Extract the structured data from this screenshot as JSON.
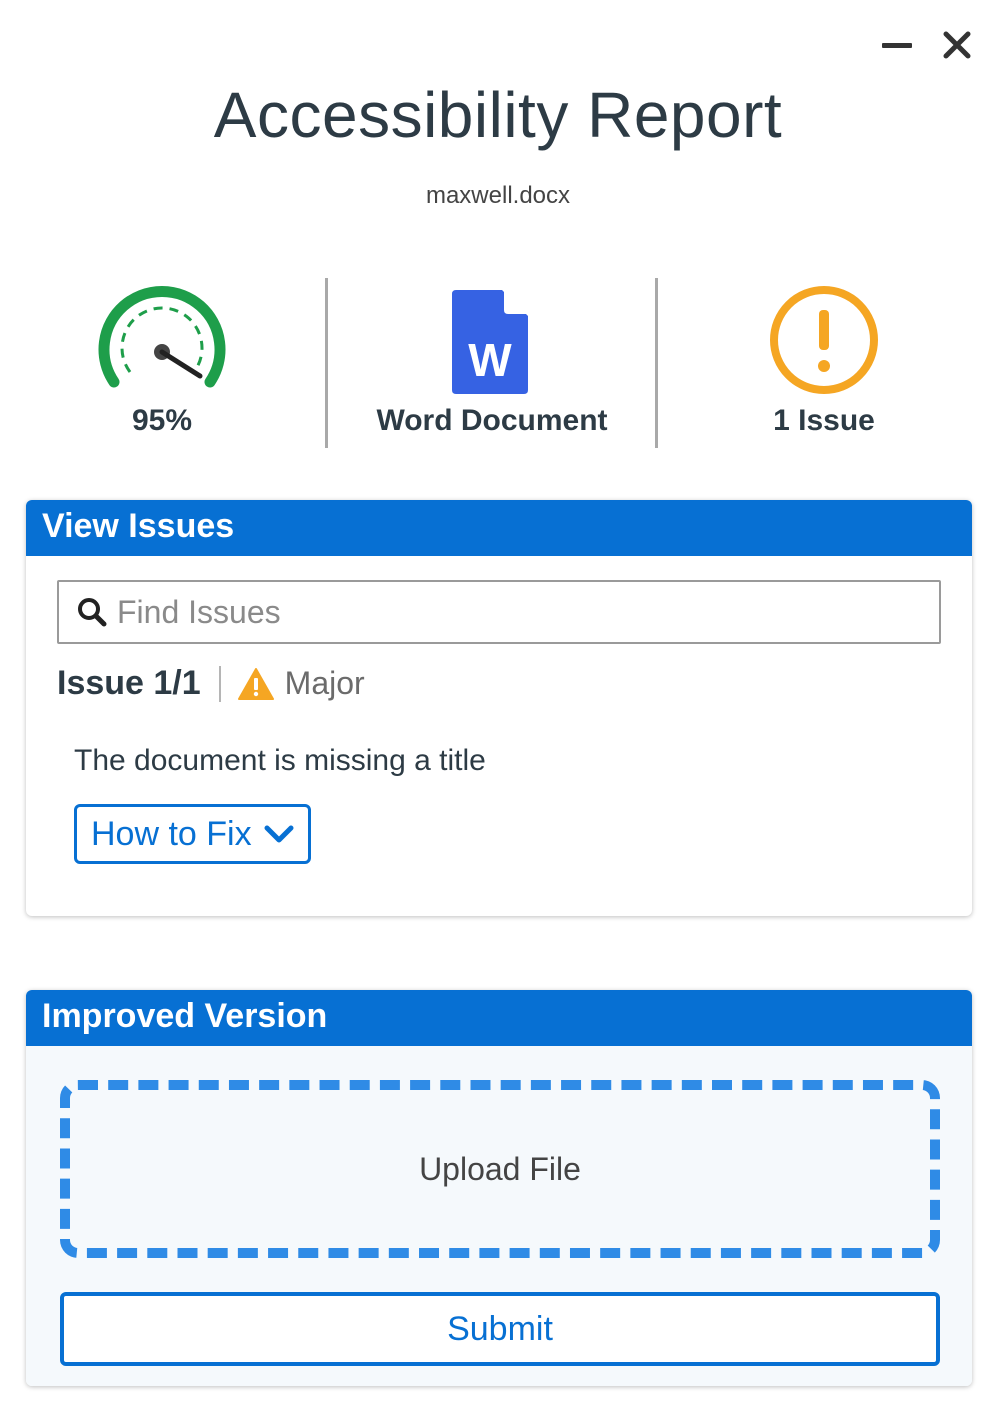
{
  "window": {
    "minimize_icon": "minimize-icon",
    "close_icon": "close-icon"
  },
  "header": {
    "title": "Accessibility Report",
    "filename": "maxwell.docx"
  },
  "stats": {
    "score": {
      "label": "95%",
      "value_percent": 95,
      "color": "#1e9e4a",
      "icon": "gauge-icon"
    },
    "doc_type": {
      "label": "Word Document",
      "icon_letter": "W",
      "color": "#3662e3",
      "icon": "word-document-icon"
    },
    "issues": {
      "label": "1 Issue",
      "icon_glyph": "!",
      "color": "#f5a623",
      "icon": "warning-circle-icon"
    }
  },
  "view_issues": {
    "header": "View Issues",
    "search": {
      "placeholder": "Find Issues",
      "value": "",
      "icon": "search-icon"
    },
    "issue_counter": "Issue 1/1",
    "severity": {
      "label": "Major",
      "icon": "warning-triangle-icon",
      "color": "#f5a623"
    },
    "description": "The document is missing a title",
    "how_to_fix_label": "How to Fix",
    "how_to_fix_icon": "chevron-down-icon"
  },
  "improved_version": {
    "header": "Improved Version",
    "upload_label": "Upload File",
    "submit_label": "Submit"
  },
  "colors": {
    "accent": "#0770d3",
    "dashed_border": "#2f8be6"
  }
}
